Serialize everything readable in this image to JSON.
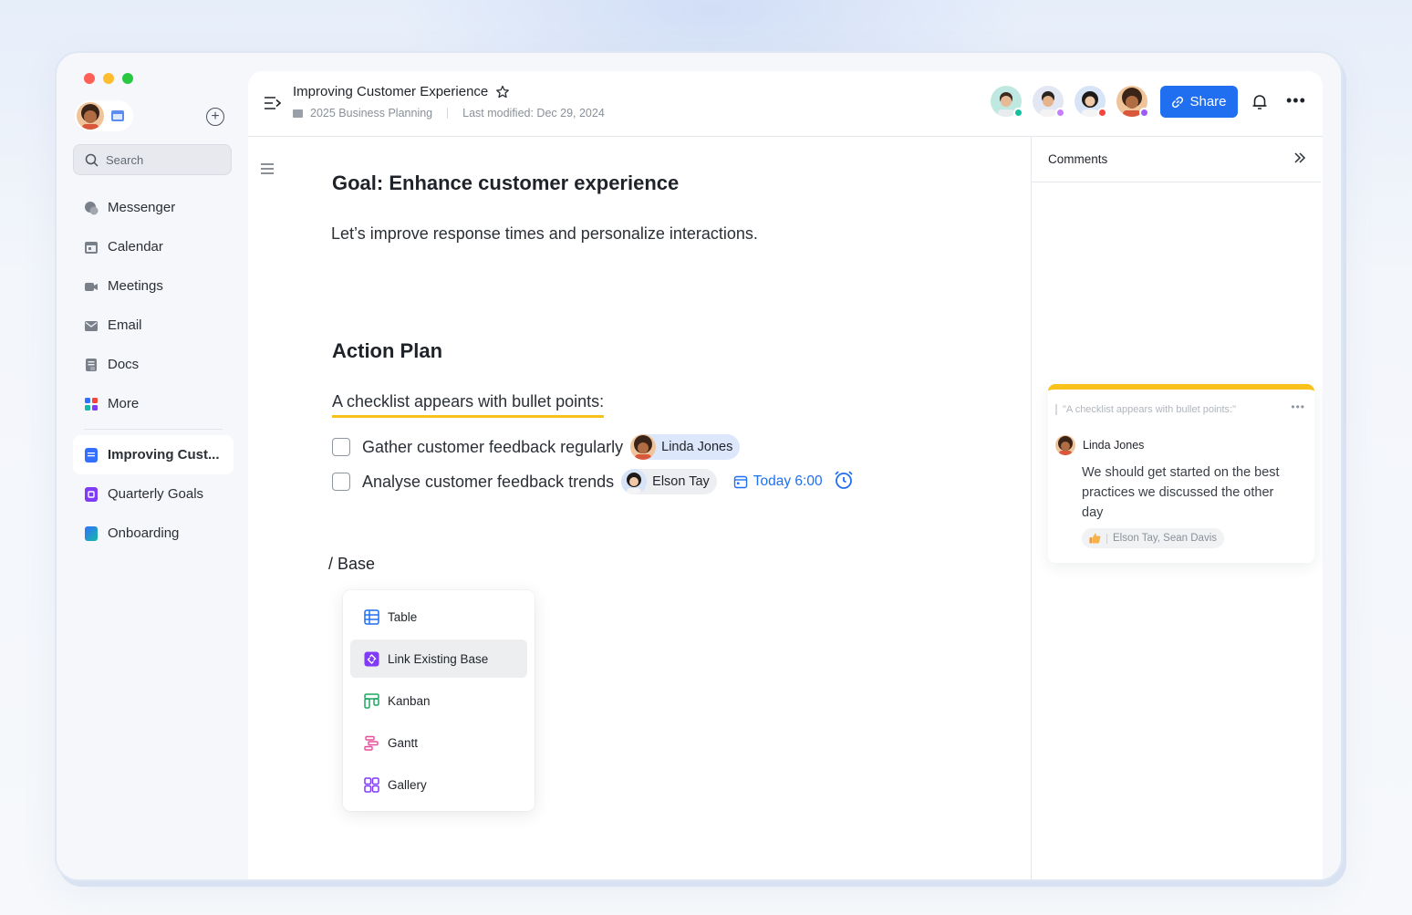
{
  "sidebar": {
    "search_placeholder": "Search",
    "items": [
      {
        "label": "Messenger",
        "icon": "chat-bubble-icon"
      },
      {
        "label": "Calendar",
        "icon": "calendar-icon"
      },
      {
        "label": "Meetings",
        "icon": "video-icon"
      },
      {
        "label": "Email",
        "icon": "mail-icon"
      },
      {
        "label": "Docs",
        "icon": "docs-icon"
      },
      {
        "label": "More",
        "icon": "apps-grid-icon"
      }
    ],
    "docs": [
      {
        "label": "Improving Cust...",
        "color": "#3370ff",
        "active": true
      },
      {
        "label": "Quarterly Goals",
        "color": "#7f3bf5",
        "active": false
      },
      {
        "label": "Onboarding",
        "color": "#14b8a6",
        "active": false
      }
    ]
  },
  "header": {
    "title": "Improving Customer Experience",
    "folder": "2025 Business Planning",
    "last_modified": "Last modified: Dec 29, 2024",
    "share_label": "Share",
    "collaborator_status_colors": [
      "#14c0a0",
      "#c77dff",
      "#f5453d",
      "#9b5cf6"
    ]
  },
  "doc": {
    "goal_heading": "Goal: Enhance customer experience",
    "intro": "Let’s improve response times and personalize interactions.",
    "action_heading": "Action Plan",
    "checklist_intro": "A checklist appears with bullet points:",
    "todos": [
      {
        "text": "Gather customer feedback regularly",
        "assignee": "Linda Jones",
        "checked": false
      },
      {
        "text": "Analyse customer feedback trends",
        "assignee": "Elson Tay",
        "checked": false,
        "due": "Today 6:00"
      }
    ],
    "slash_command": "/ Base",
    "menu": [
      {
        "label": "Table",
        "icon": "table-icon",
        "selected": false
      },
      {
        "label": "Link Existing Base",
        "icon": "link-base-icon",
        "selected": true
      },
      {
        "label": "Kanban",
        "icon": "kanban-icon",
        "selected": false
      },
      {
        "label": "Gantt",
        "icon": "gantt-icon",
        "selected": false
      },
      {
        "label": "Gallery",
        "icon": "gallery-icon",
        "selected": false
      }
    ]
  },
  "comments": {
    "title": "Comments",
    "thread": {
      "quote": "\"A checklist appears with bullet points:\"",
      "author": "Linda Jones",
      "text": "We should get started on the best practices we discussed the other day",
      "reactors": "Elson Tay, Sean Davis",
      "reaction_icon": "thumbs-up-icon"
    }
  },
  "colors": {
    "accent": "#1f6ff0",
    "highlight": "#f8c21a"
  }
}
